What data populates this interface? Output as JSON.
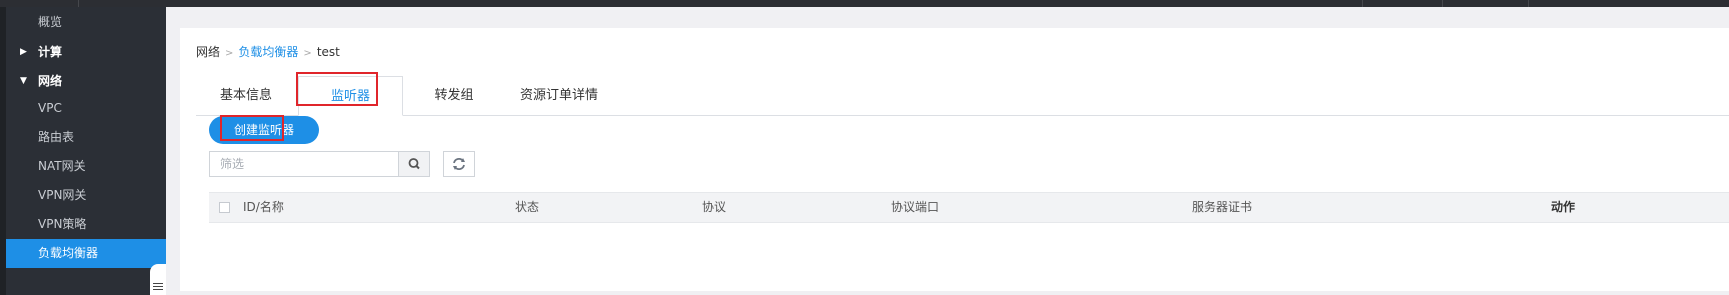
{
  "sidebar": {
    "items": [
      {
        "label": "概览",
        "kind": "sub"
      },
      {
        "label": "计算",
        "kind": "group",
        "expanded": false
      },
      {
        "label": "网络",
        "kind": "group",
        "expanded": true
      },
      {
        "label": "VPC",
        "kind": "sub"
      },
      {
        "label": "路由表",
        "kind": "sub"
      },
      {
        "label": "NAT网关",
        "kind": "sub"
      },
      {
        "label": "VPN网关",
        "kind": "sub"
      },
      {
        "label": "VPN策略",
        "kind": "sub"
      },
      {
        "label": "负载均衡器",
        "kind": "sub",
        "active": true
      }
    ]
  },
  "breadcrumb": {
    "items": [
      "网络",
      "负载均衡器",
      "test"
    ]
  },
  "tabs": [
    {
      "label": "基本信息",
      "active": false
    },
    {
      "label": "监听器",
      "active": true
    },
    {
      "label": "转发组",
      "active": false
    },
    {
      "label": "资源订单详情",
      "active": false
    }
  ],
  "toolbar": {
    "create_label": "创建监听器",
    "filter_placeholder": "筛选"
  },
  "table": {
    "columns": [
      "ID/名称",
      "状态",
      "协议",
      "协议端口",
      "服务器证书",
      "动作"
    ]
  },
  "colors": {
    "accent": "#1e8fe6",
    "highlight": "#e0252b",
    "sidebar_bg": "#2b2f36"
  },
  "icons": {
    "search": "search-icon",
    "refresh": "refresh-icon",
    "caret_right": "caret-right-icon",
    "caret_down": "caret-down-icon",
    "menu": "menu-icon"
  }
}
